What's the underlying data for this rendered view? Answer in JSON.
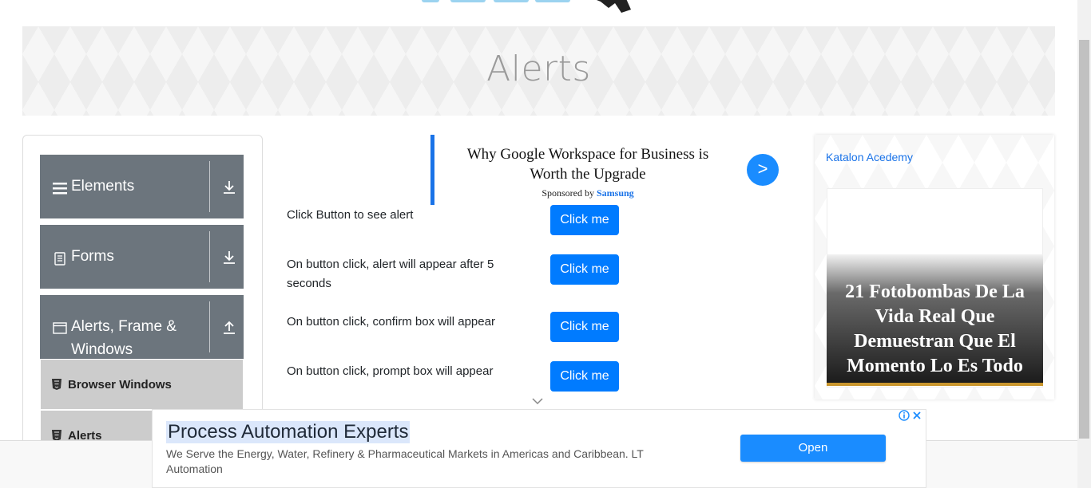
{
  "page": {
    "title": "Alerts"
  },
  "sidebar": {
    "groups": [
      {
        "label": "Elements",
        "icon": "hamburger-icon",
        "state": "collapsed"
      },
      {
        "label": "Forms",
        "icon": "document-icon",
        "state": "collapsed"
      },
      {
        "label": "Alerts, Frame &",
        "label2": "Windows",
        "icon": "window-icon",
        "state": "expanded"
      }
    ],
    "items": [
      {
        "label": "Browser Windows",
        "icon": "html5-icon"
      },
      {
        "label": "Alerts",
        "icon": "html5-icon"
      }
    ]
  },
  "sponsored": {
    "headline_line1": "Why Google Workspace for Business is",
    "headline_line2": "Worth the Upgrade",
    "sponsor_prefix": "Sponsored by",
    "sponsor_name": "Samsung",
    "go_label": ">",
    "accent": "#1a73e8"
  },
  "alerts": [
    {
      "label": "Click Button to see alert",
      "button": "Click me"
    },
    {
      "label": "On button click, alert will appear after 5 seconds",
      "button": "Click me"
    },
    {
      "label": "On button click, confirm box will appear",
      "button": "Click me"
    },
    {
      "label": "On button click, prompt box will appear",
      "button": "Click me"
    }
  ],
  "right_ad": {
    "image_alt": "Katalon Acedemy",
    "caption": "21 Fotobombas De La Vida Real Que Demuestran Que El Momento Lo Es Todo"
  },
  "bottom_ad": {
    "title": "Process Automation Experts",
    "description": "We Serve the Energy, Water, Refinery & Pharmaceutical Markets in Americas and Caribbean. LT Automation",
    "button": "Open"
  },
  "colors": {
    "primary_button": "#007bff",
    "sidebar_group": "#6c757d",
    "sidebar_item": "#cccccc"
  }
}
